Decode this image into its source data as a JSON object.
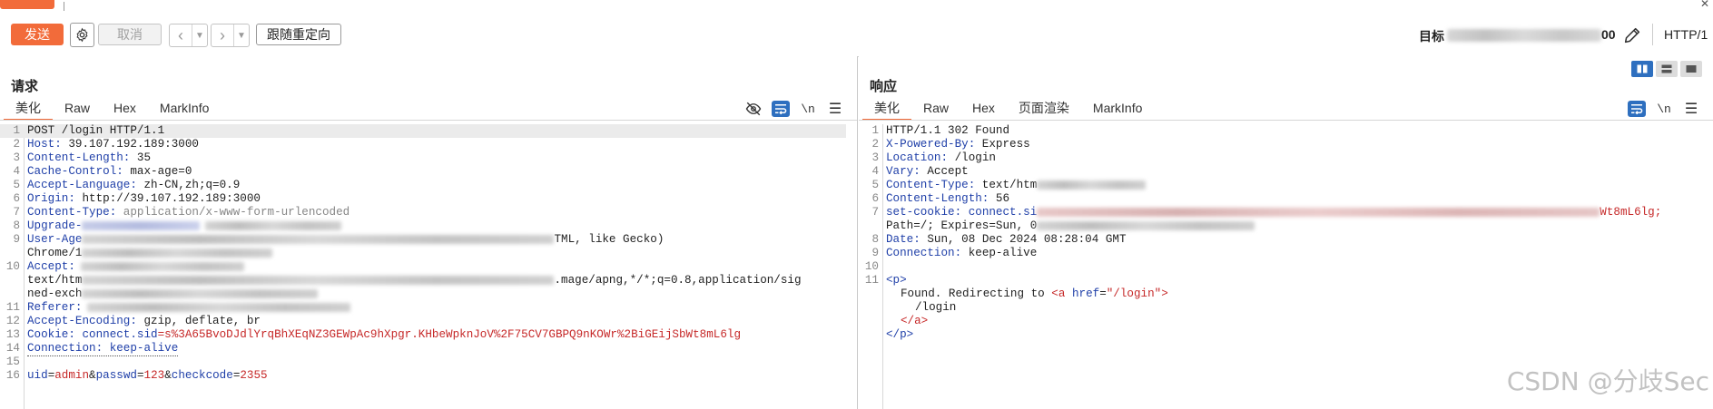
{
  "toolbar": {
    "send_label": "发送",
    "cancel_label": "取消",
    "follow_redirect_label": "跟随重定向",
    "target_label": "目标",
    "target_tail": "00",
    "http_version": "HTTP/1"
  },
  "request": {
    "title": "请求",
    "tabs": [
      "美化",
      "Raw",
      "Hex",
      "MarkInfo"
    ],
    "lines": {
      "l1": "POST /login HTTP/1.1",
      "l2k": "Host:",
      "l2v": " 39.107.192.189:3000",
      "l3k": "Content-Length:",
      "l3v": " 35",
      "l4k": "Cache-Control:",
      "l4v": " max-age=0",
      "l5k": "Accept-Language:",
      "l5v": " zh-CN,zh;q=0.9",
      "l6k": "Origin:",
      "l6v": " http://39.107.192.189:3000",
      "l7k": "Content-Type:",
      "l7v": " application/x-www-form-urlencoded",
      "l8k": "Upgrade-",
      "l9k": "User-Age",
      "l9v": "TML, like Gecko)",
      "l9b": "Chrome/1",
      "l10k": "Accept:",
      "l10b": "text/htm",
      "l10c": ".mage/apng,*/*;q=0.8,application/sig",
      "l10d": "ned-exch",
      "l11k": "Referer:",
      "l12k": "Accept-Encoding:",
      "l12v": " gzip, deflate, br",
      "l13k": "Cookie:",
      "l13n": " connect.sid",
      "l13v": "=s%3A65BvoDJdlYrqBhXEqNZ3GEWpAc9hXpgr.KHbeWpknJoV%2F75CV7GBPQ9nKOWr%2BiGEijSbWt8mL6lg",
      "l14": "Connection: keep-alive",
      "l16a": "uid",
      "l16b": "=",
      "l16c": "admin",
      "l16d": "&",
      "l16e": "passwd",
      "l16f": "=",
      "l16g": "123",
      "l16h": "&",
      "l16i": "checkcode",
      "l16j": "=",
      "l16k": "2355"
    }
  },
  "response": {
    "title": "响应",
    "tabs": [
      "美化",
      "Raw",
      "Hex",
      "页面渲染",
      "MarkInfo"
    ],
    "lines": {
      "l1": "HTTP/1.1 302 Found",
      "l2k": "X-Powered-By:",
      "l2v": " Express",
      "l3k": "Location:",
      "l3v": " /login",
      "l4k": "Vary:",
      "l4v": " Accept",
      "l5k": "Content-Type:",
      "l5v": " text/htm",
      "l6k": "Content-Length:",
      "l6v": " 56",
      "l7k": "set-cookie:",
      "l7n": " connect.si",
      "l7t": "Wt8mL6lg;",
      "l7b": "Path=/; Expires=Sun, 0",
      "l8k": "Date:",
      "l8v": " Sun, 08 Dec 2024 08:28:04 GMT",
      "l9k": "Connection:",
      "l9v": " keep-alive",
      "l11": "<p>",
      "l11b_text": "Found. Redirecting to ",
      "l11b_open": "<a",
      "l11b_attr": " href",
      "l11b_eq": "=",
      "l11b_val": "\"/login\"",
      "l11b_close": ">",
      "l11c": "/login",
      "l11d": "</a>",
      "l11e": "</p>"
    }
  },
  "watermark": "CSDN @分歧Sec",
  "colors": {
    "accent": "#f26b3a",
    "wrap_active": "#2e6fbf",
    "header_key": "#1f3fa8",
    "param_value": "#c62828"
  }
}
